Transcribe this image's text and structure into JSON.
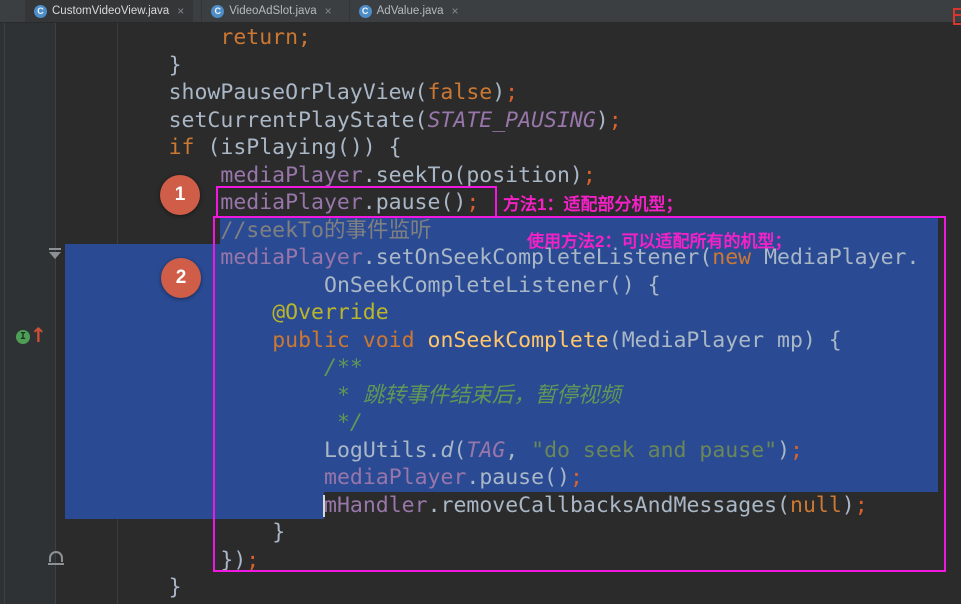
{
  "ui": {
    "tab_icon": "C",
    "close_glyph": "×",
    "tabs": [
      {
        "label": "CustomVideoView.java",
        "active": true
      },
      {
        "label": "VideoAdSlot.java",
        "active": false
      },
      {
        "label": "AdValue.java",
        "active": false
      }
    ]
  },
  "icons": {
    "override_letter": "I",
    "override_arrow": "↑"
  },
  "annotations": {
    "method1": "方法1：适配部分机型；",
    "method2": "使用方法2：可以适配所有的机型；",
    "step1": "1",
    "step2": "2"
  },
  "colors": {
    "editor_background": "#2b2b2b",
    "tabbar_background": "#3c3f41",
    "selection_blue": "#2a4b93",
    "highlight_box_magenta": "#f018e0",
    "annotation_magenta": "#f321c7",
    "step_marker_red": "#cf5d47",
    "keyword_orange": "#cc7832",
    "field_purple": "#9876aa",
    "string_green": "#6a8759",
    "method_yellow": "#ffc66b"
  },
  "code": {
    "caret": {
      "line": 17,
      "col": 20
    },
    "lines": [
      {
        "col": 12,
        "segs": [
          [
            "return;",
            "kw"
          ]
        ]
      },
      {
        "col": 8,
        "segs": [
          [
            "}",
            "pl"
          ]
        ]
      },
      {
        "col": 8,
        "segs": [
          [
            "showPauseOrPlayView(",
            "pl"
          ],
          [
            "false",
            "kw"
          ],
          [
            ")",
            "pl"
          ],
          [
            ";",
            "sc"
          ]
        ]
      },
      {
        "col": 8,
        "segs": [
          [
            "setCurrentPlayState(",
            "pl"
          ],
          [
            "STATE_PAUSING",
            "cst"
          ],
          [
            ")",
            "pl"
          ],
          [
            ";",
            "sc"
          ]
        ]
      },
      {
        "col": 8,
        "segs": [
          [
            "if ",
            "kw"
          ],
          [
            "(isPlaying()) {",
            "pl"
          ]
        ]
      },
      {
        "col": 12,
        "segs": [
          [
            "mediaPlayer",
            "fld"
          ],
          [
            ".seekTo(position)",
            "pl"
          ],
          [
            ";",
            "sc"
          ]
        ]
      },
      {
        "col": 12,
        "segs": [
          [
            "mediaPlayer",
            "fld"
          ],
          [
            ".pause()",
            "pl"
          ],
          [
            ";",
            "sc"
          ]
        ]
      },
      {
        "col": 12,
        "sel": "from-text",
        "segs": [
          [
            "//seekTo的事件监听",
            "cmt"
          ]
        ]
      },
      {
        "col": 12,
        "sel": "full",
        "segs": [
          [
            "mediaPlayer",
            "fld"
          ],
          [
            ".setOnSeekCompleteListener(",
            "pl"
          ],
          [
            "new",
            "kw"
          ],
          [
            " MediaPlayer.",
            "pl"
          ]
        ]
      },
      {
        "col": 20,
        "sel": "full",
        "segs": [
          [
            "OnSeekCompleteListener() {",
            "pl"
          ]
        ]
      },
      {
        "col": 16,
        "sel": "full",
        "segs": [
          [
            "@Override",
            "ann"
          ]
        ]
      },
      {
        "col": 16,
        "sel": "full",
        "segs": [
          [
            "public void ",
            "kw"
          ],
          [
            "onSeekComplete",
            "mth"
          ],
          [
            "(MediaPlayer mp) {",
            "pl"
          ]
        ]
      },
      {
        "col": 20,
        "sel": "full",
        "segs": [
          [
            "/**",
            "doc"
          ]
        ]
      },
      {
        "col": 21,
        "sel": "full",
        "segs": [
          [
            "* 跳转事件结束后，暂停视频",
            "doc"
          ]
        ]
      },
      {
        "col": 21,
        "sel": "full",
        "segs": [
          [
            "*/",
            "doc"
          ]
        ]
      },
      {
        "col": 20,
        "sel": "full",
        "segs": [
          [
            "LogUtils.",
            "pl"
          ],
          [
            "d",
            "itl"
          ],
          [
            "(",
            "pl"
          ],
          [
            "TAG",
            "cst"
          ],
          [
            ", ",
            "pl"
          ],
          [
            "\"do seek and pause\"",
            "str"
          ],
          [
            ")",
            "pl"
          ],
          [
            ";",
            "sc"
          ]
        ]
      },
      {
        "col": 20,
        "sel": "full",
        "segs": [
          [
            "mediaPlayer",
            "fld"
          ],
          [
            ".pause()",
            "pl"
          ],
          [
            ";",
            "sc"
          ]
        ]
      },
      {
        "col": 20,
        "sel": "to-caret",
        "segs": [
          [
            "mHandler",
            "fld"
          ],
          [
            ".removeCallbacksAndMessages(",
            "pl"
          ],
          [
            "null",
            "kw"
          ],
          [
            ")",
            "pl"
          ],
          [
            ";",
            "sc"
          ]
        ]
      },
      {
        "col": 16,
        "segs": [
          [
            "}",
            "pl"
          ]
        ]
      },
      {
        "col": 12,
        "segs": [
          [
            "})",
            "pl"
          ],
          [
            ";",
            "sc"
          ]
        ]
      },
      {
        "col": 8,
        "segs": [
          [
            "}",
            "pl"
          ]
        ]
      }
    ]
  }
}
